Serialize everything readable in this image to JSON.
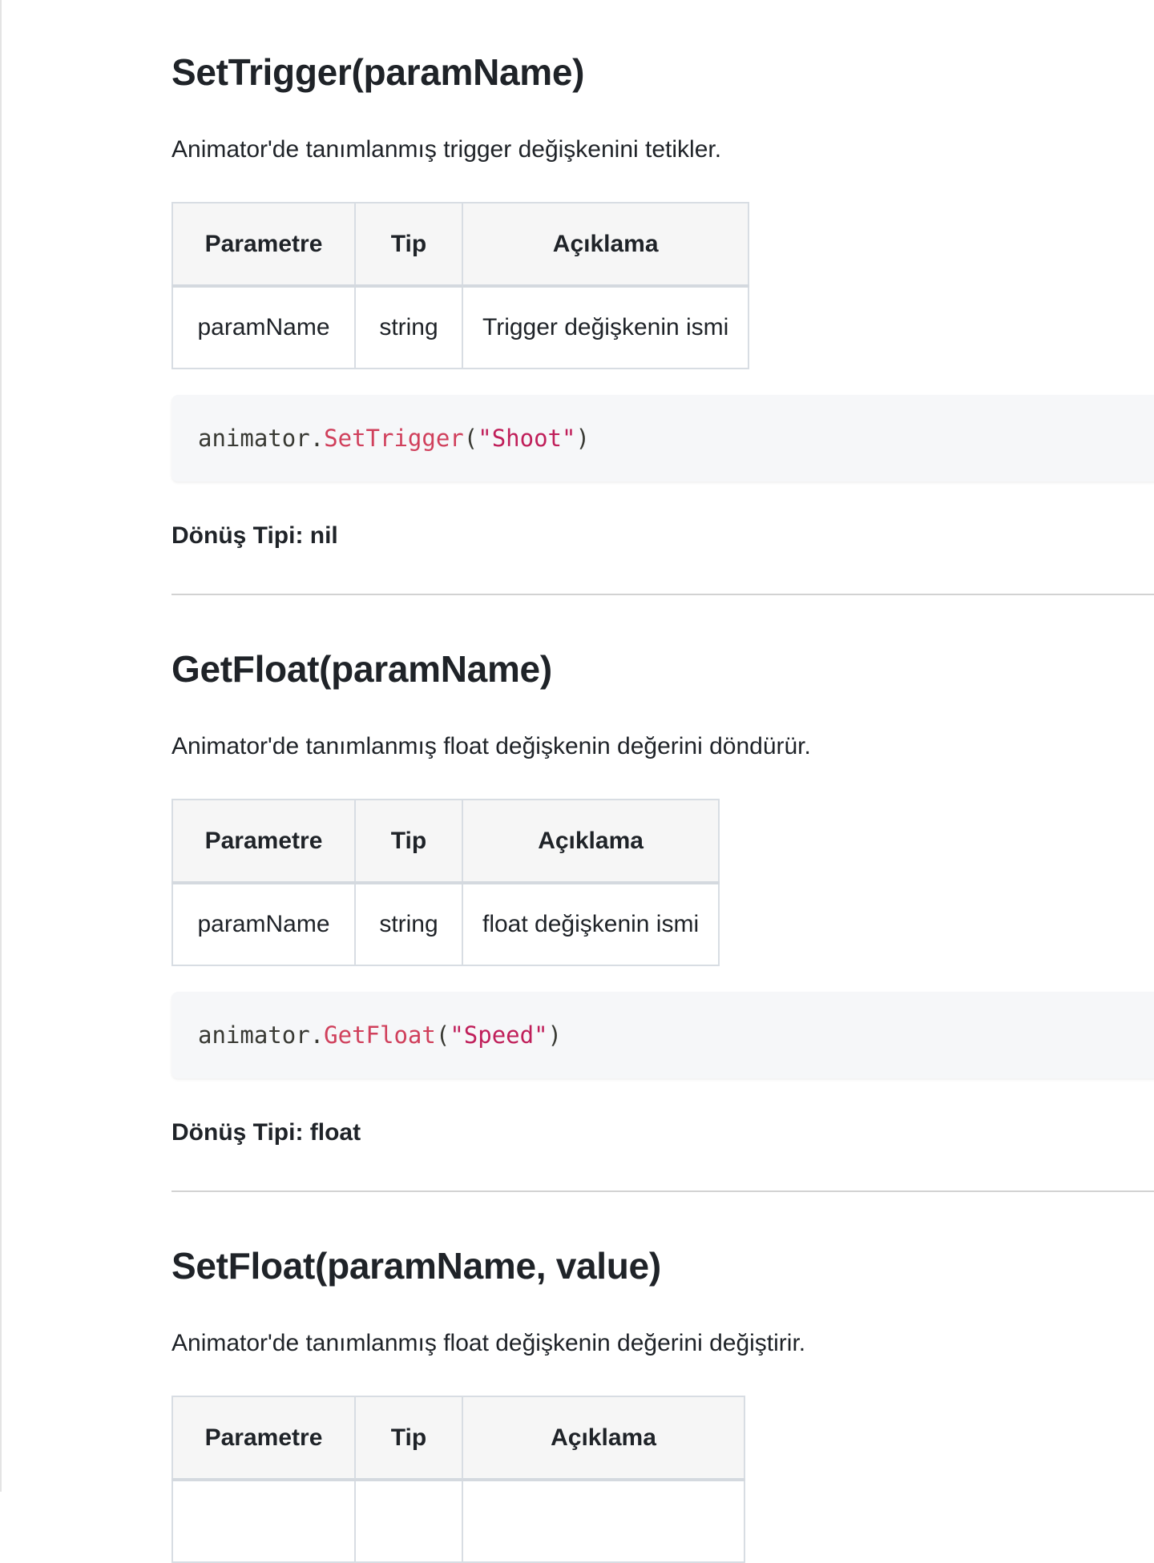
{
  "sections": [
    {
      "title": "SetTrigger(paramName)",
      "description": "Animator'de tanımlanmış trigger değişkenini tetikler.",
      "table": {
        "headers": [
          "Parametre",
          "Tip",
          "Açıklama"
        ],
        "rows": [
          [
            "paramName",
            "string",
            "Trigger değişkenin ismi"
          ]
        ]
      },
      "code": {
        "object": "animator",
        "dot": ".",
        "method": "SetTrigger",
        "open": "(",
        "arg": "\"Shoot\"",
        "close": ")"
      },
      "return_type": "Dönüş Tipi: nil"
    },
    {
      "title": "GetFloat(paramName)",
      "description": "Animator'de tanımlanmış float değişkenin değerini döndürür.",
      "table": {
        "headers": [
          "Parametre",
          "Tip",
          "Açıklama"
        ],
        "rows": [
          [
            "paramName",
            "string",
            "float değişkenin ismi"
          ]
        ]
      },
      "code": {
        "object": "animator",
        "dot": ".",
        "method": "GetFloat",
        "open": "(",
        "arg": "\"Speed\"",
        "close": ")"
      },
      "return_type": "Dönüş Tipi: float"
    },
    {
      "title": "SetFloat(paramName, value)",
      "description": "Animator'de tanımlanmış float değişkenin değerini değiştirir.",
      "table": {
        "headers": [
          "Parametre",
          "Tip",
          "Açıklama"
        ],
        "rows": []
      }
    }
  ]
}
